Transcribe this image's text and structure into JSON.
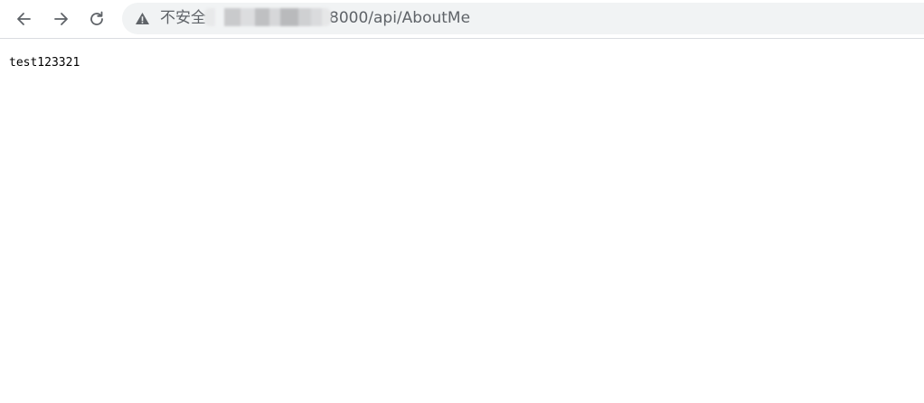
{
  "browser": {
    "security_label": "不安全",
    "url_visible": "8000/api/AboutMe",
    "icons": {
      "back": "back-arrow-icon",
      "forward": "forward-arrow-icon",
      "reload": "reload-icon",
      "warning": "warning-triangle-icon"
    }
  },
  "page": {
    "body_text": "test123321"
  }
}
